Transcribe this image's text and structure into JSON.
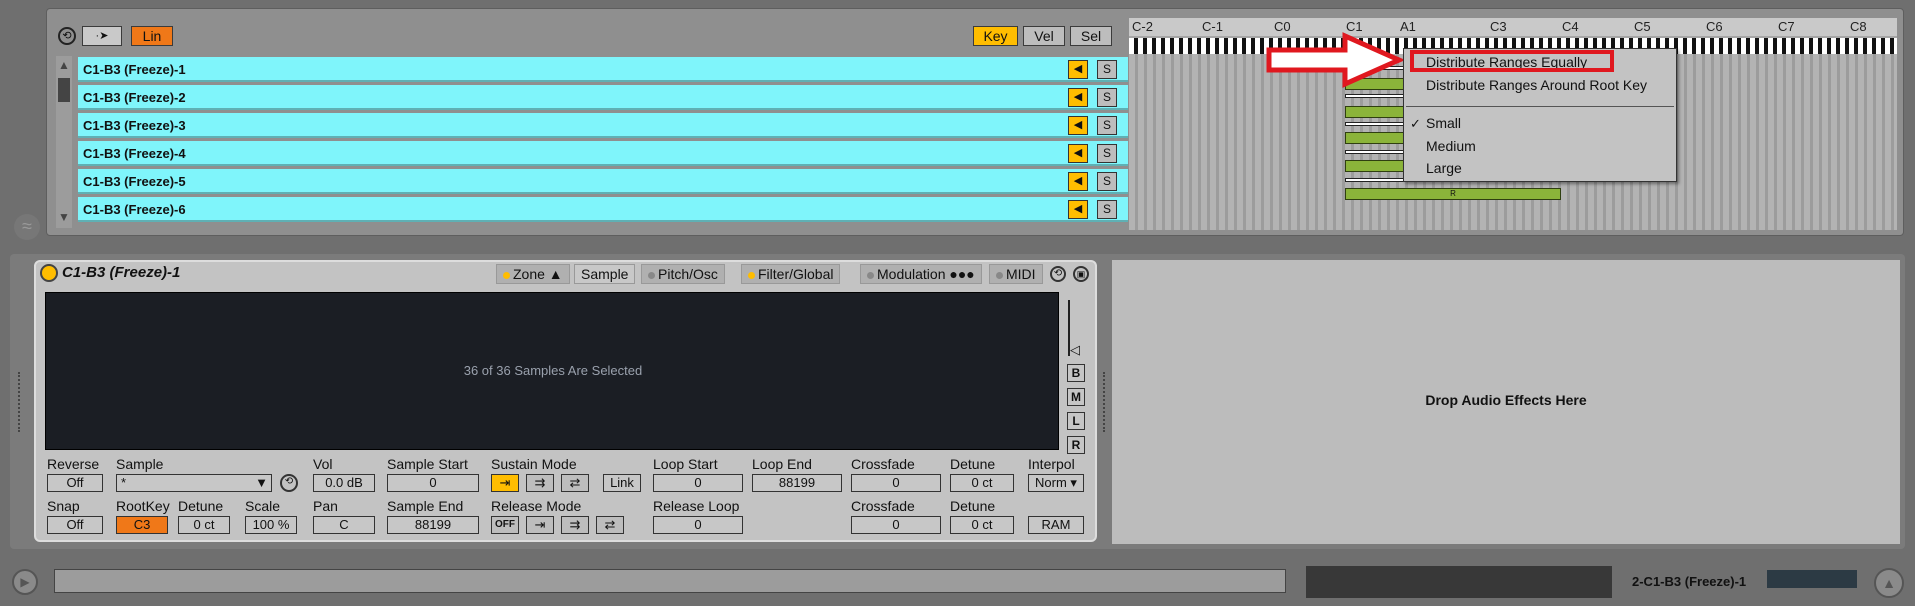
{
  "toolbar": {
    "lin": "Lin",
    "key": "Key",
    "vel": "Vel",
    "sel": "Sel"
  },
  "note_labels": [
    "C-2",
    "C-1",
    "C0",
    "C1",
    "A1",
    "C3",
    "C4",
    "C5",
    "C6",
    "C7",
    "C8"
  ],
  "rows": [
    {
      "label": "C1-B3 (Freeze)-1"
    },
    {
      "label": "C1-B3 (Freeze)-2"
    },
    {
      "label": "C1-B3 (Freeze)-3"
    },
    {
      "label": "C1-B3 (Freeze)-4"
    },
    {
      "label": "C1-B3 (Freeze)-5"
    },
    {
      "label": "C1-B3 (Freeze)-6"
    }
  ],
  "row_solo": "S",
  "zone_marker": "R",
  "context_menu": {
    "items": [
      "Distribute Ranges Equally",
      "Distribute Ranges Around Root Key"
    ],
    "sizes": [
      "Small",
      "Medium",
      "Large"
    ],
    "checked": "✓"
  },
  "sampler": {
    "title": "C1-B3 (Freeze)-1",
    "tabs": [
      "Zone",
      "Sample",
      "Pitch/Osc",
      "Filter/Global",
      "Modulation",
      "MIDI"
    ],
    "display_msg": "36 of 36 Samples Are Selected",
    "side_buttons": [
      "B",
      "M",
      "L",
      "R"
    ],
    "labels": {
      "reverse": "Reverse",
      "sample": "Sample",
      "vol": "Vol",
      "sample_start": "Sample Start",
      "sustain_mode": "Sustain Mode",
      "loop_start": "Loop Start",
      "loop_end": "Loop End",
      "crossfade": "Crossfade",
      "detune": "Detune",
      "interpol": "Interpol",
      "snap": "Snap",
      "rootkey": "RootKey",
      "detune2": "Detune",
      "scale": "Scale",
      "pan": "Pan",
      "sample_end": "Sample End",
      "release_mode": "Release Mode",
      "release_loop": "Release Loop",
      "crossfade2": "Crossfade",
      "detune3": "Detune"
    },
    "values": {
      "reverse": "Off",
      "sample": "*",
      "vol": "0.0 dB",
      "sample_start": "0",
      "link": "Link",
      "loop_start": "0",
      "loop_end": "88199",
      "crossfade": "0",
      "detune": "0 ct",
      "interpol": "Norm",
      "snap": "Off",
      "rootkey": "C3",
      "detune2": "0 ct",
      "scale": "100 %",
      "pan": "C",
      "sample_end": "88199",
      "release_off": "OFF",
      "release_loop": "0",
      "crossfade2": "0",
      "detune3": "0 ct",
      "ram": "RAM"
    }
  },
  "drop_msg": "Drop Audio Effects Here",
  "track_name": "2-C1-B3 (Freeze)-1",
  "colors": {
    "accent": "#ffbd00",
    "row": "#7ff5fb",
    "zone": "#8bb43a",
    "highlight": "#e0181f"
  }
}
